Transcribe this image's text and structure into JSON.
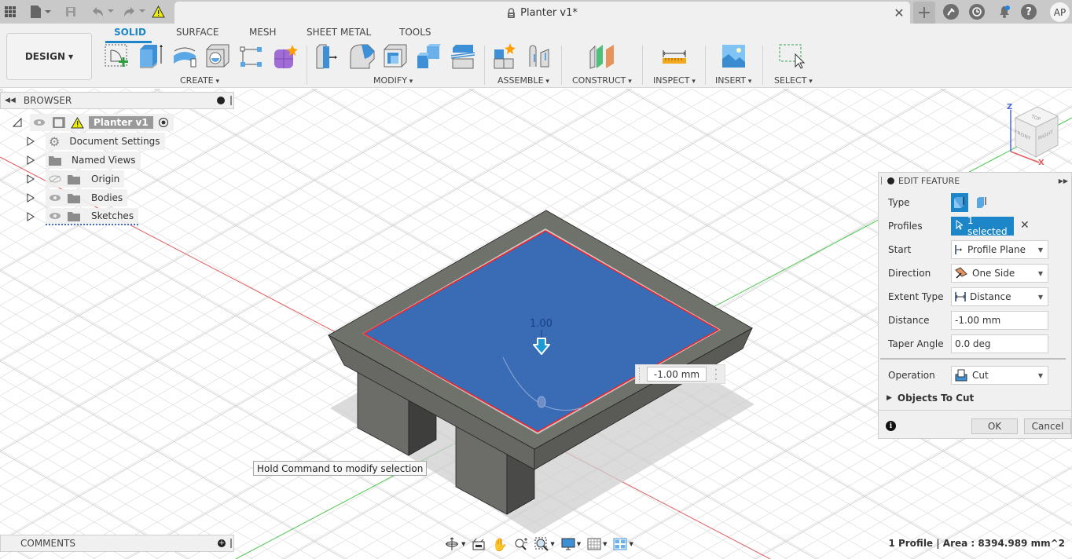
{
  "titlebar": {
    "document_title": "Planter v1*",
    "user_initials": "AP",
    "icons": [
      "grid-apps-icon",
      "file-icon",
      "save-icon",
      "undo-icon",
      "redo-icon",
      "warning-icon",
      "lock-icon",
      "close-icon",
      "plus-icon",
      "extensions-icon",
      "job-status-icon",
      "notifications-icon",
      "help-icon"
    ]
  },
  "ribbon": {
    "workspace_button": "DESIGN",
    "tabs": [
      {
        "label": "SOLID",
        "active": true
      },
      {
        "label": "SURFACE",
        "active": false
      },
      {
        "label": "MESH",
        "active": false
      },
      {
        "label": "SHEET METAL",
        "active": false
      },
      {
        "label": "TOOLS",
        "active": false
      }
    ],
    "groups": [
      {
        "label": "CREATE",
        "tools": [
          "create-sketch",
          "extrude",
          "revolve",
          "hole",
          "pattern",
          "create-form"
        ]
      },
      {
        "label": "MODIFY",
        "tools": [
          "press-pull",
          "fillet",
          "shell",
          "combine",
          "split-body"
        ]
      },
      {
        "label": "ASSEMBLE",
        "tools": [
          "new-component",
          "joint"
        ]
      },
      {
        "label": "CONSTRUCT",
        "tools": [
          "offset-plane"
        ]
      },
      {
        "label": "INSPECT",
        "tools": [
          "measure"
        ]
      },
      {
        "label": "INSERT",
        "tools": [
          "insert-image"
        ]
      },
      {
        "label": "SELECT",
        "tools": [
          "window-select"
        ]
      }
    ]
  },
  "browser": {
    "title": "BROWSER",
    "root": {
      "label": "Planter v1",
      "has_warning": true
    },
    "items": [
      {
        "label": "Document Settings",
        "icon": "gear-icon",
        "visibility": "none"
      },
      {
        "label": "Named Views",
        "icon": "folder-icon",
        "visibility": "none"
      },
      {
        "label": "Origin",
        "icon": "folder-icon",
        "visibility": "hidden"
      },
      {
        "label": "Bodies",
        "icon": "folder-icon",
        "visibility": "visible"
      },
      {
        "label": "Sketches",
        "icon": "folder-icon",
        "visibility": "visible"
      }
    ]
  },
  "comments": {
    "title": "COMMENTS"
  },
  "edit_feature": {
    "title": "EDIT FEATURE",
    "type_label": "Type",
    "profiles_label": "Profiles",
    "profiles_value": "1 selected",
    "start_label": "Start",
    "start_value": "Profile Plane",
    "direction_label": "Direction",
    "direction_value": "One Side",
    "extent_type_label": "Extent Type",
    "extent_type_value": "Distance",
    "distance_label": "Distance",
    "distance_value": "-1.00 mm",
    "taper_angle_label": "Taper Angle",
    "taper_angle_value": "0.0 deg",
    "operation_label": "Operation",
    "operation_value": "Cut",
    "objects_to_cut_label": "Objects To Cut",
    "ok_label": "OK",
    "cancel_label": "Cancel"
  },
  "viewport": {
    "dimension_label": "1.00",
    "distance_input": "-1.00 mm",
    "tooltip": "Hold Command to modify selection",
    "viewcube": {
      "top": "TOP",
      "front": "FRONT",
      "right": "RIGHT",
      "axis_z": "Z",
      "axis_x": "X"
    },
    "colors": {
      "selected_face": "#3a6bb5",
      "profile_edge": "#ff2020",
      "body": "#6c6e69",
      "x_axis": "#e35d5d",
      "y_axis": "#4ec94e"
    }
  },
  "navbar": {
    "tools": [
      "orbit",
      "look-at",
      "pan",
      "zoom",
      "fit",
      "display-settings",
      "grid-settings",
      "viewports"
    ]
  },
  "status": {
    "text": "1 Profile | Area : 8394.989 mm^2"
  }
}
